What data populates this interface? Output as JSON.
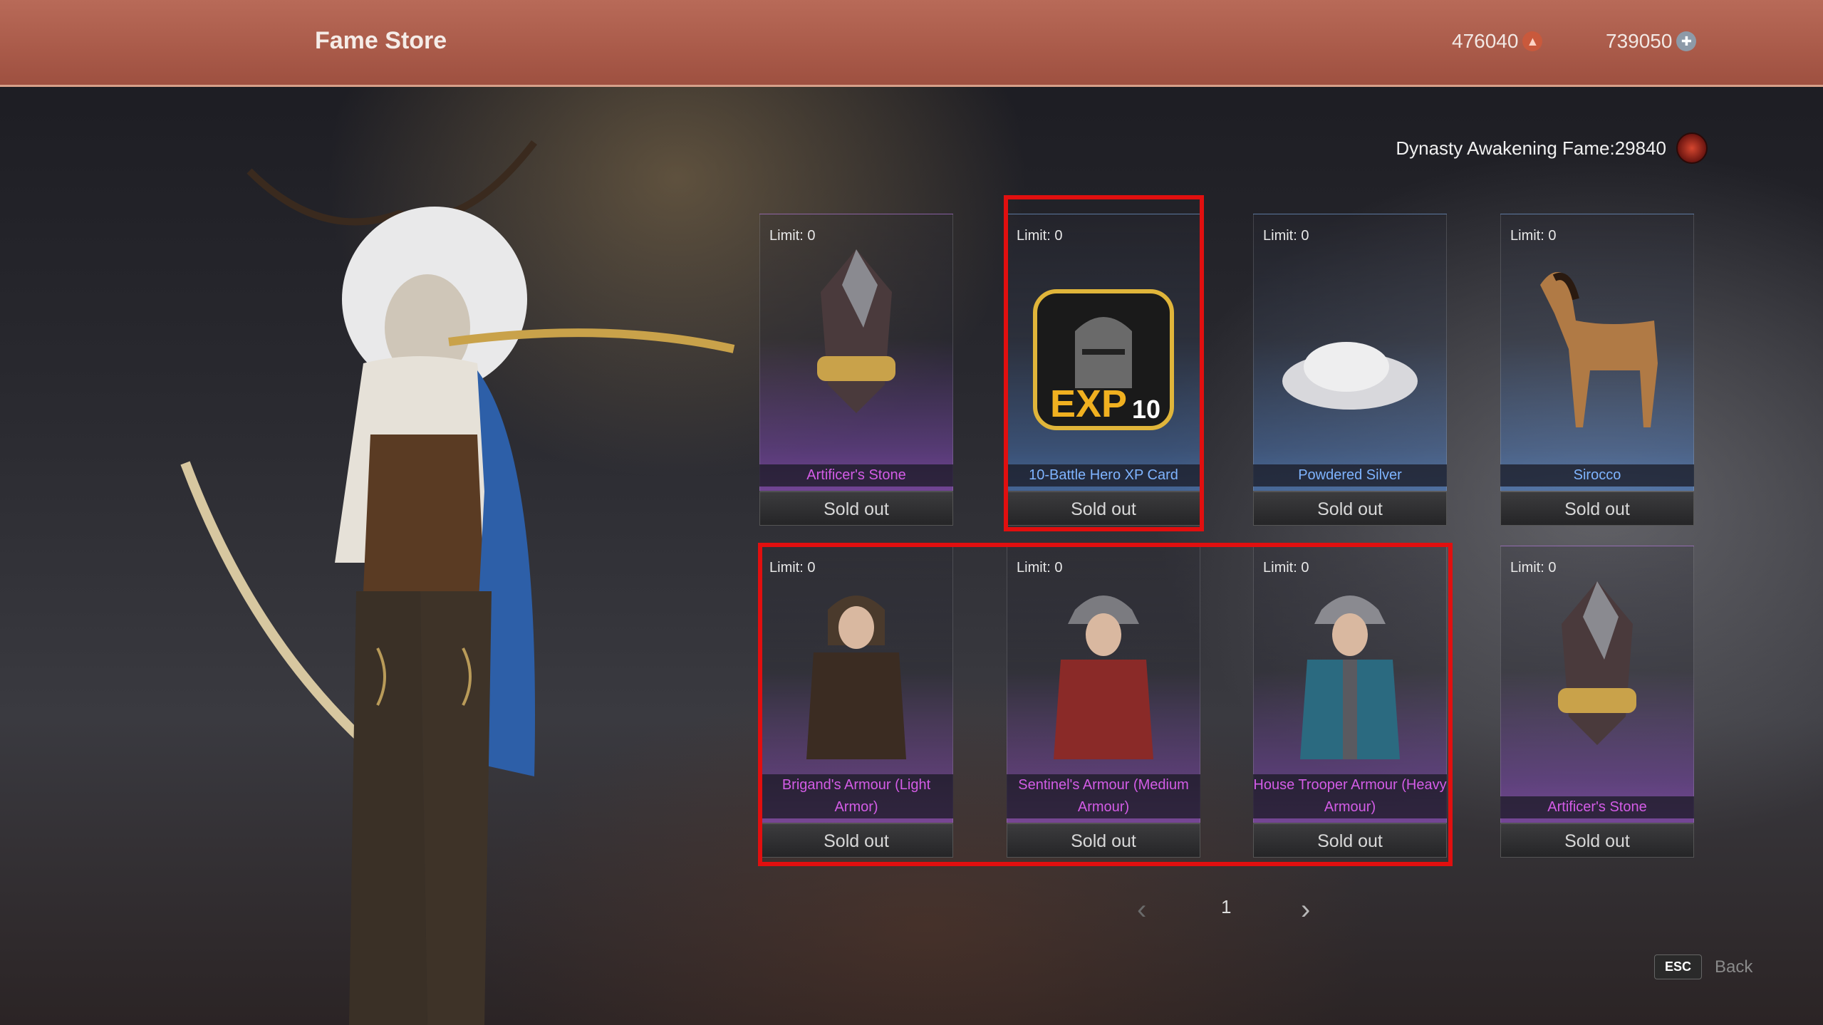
{
  "header": {
    "title": "Fame Store",
    "currency_1": "476040",
    "currency_2": "739050"
  },
  "fame": {
    "label": "Dynasty Awakening Fame:29840"
  },
  "items": [
    {
      "limit": "Limit: 0",
      "name": "Artificer's Stone",
      "status": "Sold out",
      "rarity": "purple"
    },
    {
      "limit": "Limit: 0",
      "name": "10-Battle Hero XP Card",
      "status": "Sold out",
      "rarity": "blue"
    },
    {
      "limit": "Limit: 0",
      "name": "Powdered Silver",
      "status": "Sold out",
      "rarity": "blue"
    },
    {
      "limit": "Limit: 0",
      "name": "Sirocco",
      "status": "Sold out",
      "rarity": "blue"
    },
    {
      "limit": "Limit: 0",
      "name": "Brigand's Armour (Light Armor)",
      "status": "Sold out",
      "rarity": "purple"
    },
    {
      "limit": "Limit: 0",
      "name": "Sentinel's Armour (Medium Armour)",
      "status": "Sold out",
      "rarity": "purple"
    },
    {
      "limit": "Limit: 0",
      "name": "House Trooper Armour (Heavy Armour)",
      "status": "Sold out",
      "rarity": "purple"
    },
    {
      "limit": "Limit: 0",
      "name": "Artificer's Stone",
      "status": "Sold out",
      "rarity": "purple"
    }
  ],
  "xp_card": {
    "label": "EXP",
    "count": "10"
  },
  "pagination": {
    "page": "1",
    "prev_icon": "chevron-left-icon",
    "next_icon": "chevron-right-icon"
  },
  "footer": {
    "esc_key": "ESC",
    "back_label": "Back"
  },
  "colors": {
    "highlight": "#e10f0f",
    "purple_name": "#d35ce6",
    "blue_name": "#7fb4ff",
    "topbar": "#a95a49"
  }
}
